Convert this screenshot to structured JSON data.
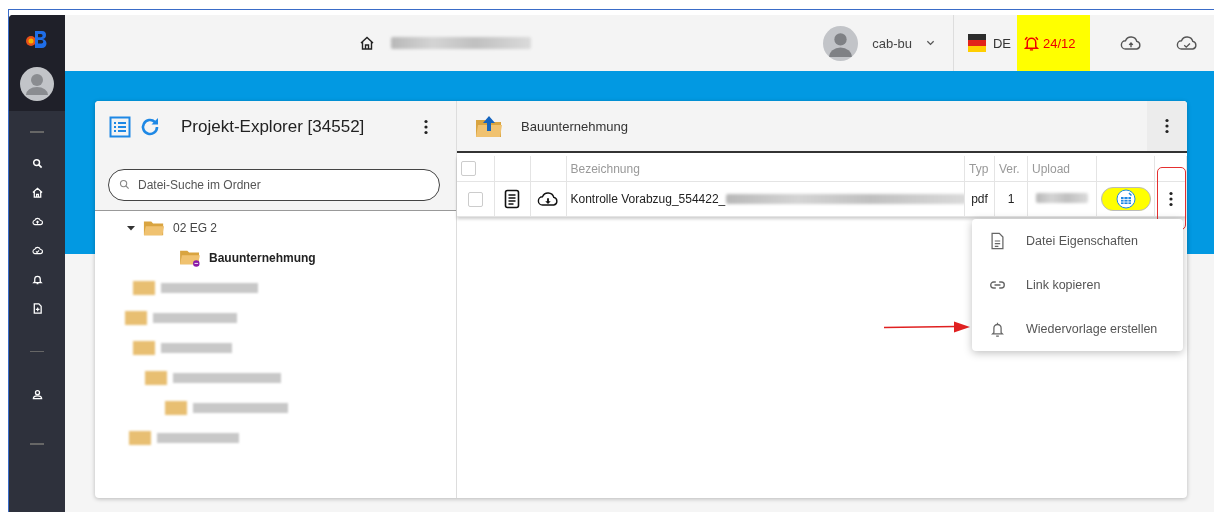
{
  "header": {
    "user": "cab-bu",
    "language": "DE",
    "notifications": "24/12"
  },
  "explorer": {
    "title": "Projekt-Explorer [34552]",
    "search": {
      "placeholder": "Datei-Suche im Ordner"
    },
    "tree": [
      {
        "kind": "folder",
        "label": "02 EG 2",
        "expanded": true,
        "selected": false,
        "children": [
          {
            "label": "Bauunternehmung",
            "selected": true
          }
        ]
      },
      {
        "kind": "redacted"
      },
      {
        "kind": "redacted"
      },
      {
        "kind": "redacted"
      },
      {
        "kind": "redacted"
      },
      {
        "kind": "redacted"
      },
      {
        "kind": "redacted"
      }
    ]
  },
  "folder": {
    "title": "Bauunternehmung",
    "table": {
      "all_checked": false,
      "columns": [
        "Bezeichnung",
        "Typ",
        "Ver.",
        "Upload"
      ],
      "rows": [
        {
          "checked": false,
          "name": "Kontrolle Vorabzug_554422_",
          "type": "pdf",
          "version": "1"
        }
      ]
    }
  },
  "menu": {
    "items": [
      {
        "kind": "file",
        "label": "Datei Eigenschaften"
      },
      {
        "kind": "link",
        "label": "Link kopieren"
      },
      {
        "kind": "bell",
        "label": "Wiedervorlage erstellen"
      }
    ]
  }
}
